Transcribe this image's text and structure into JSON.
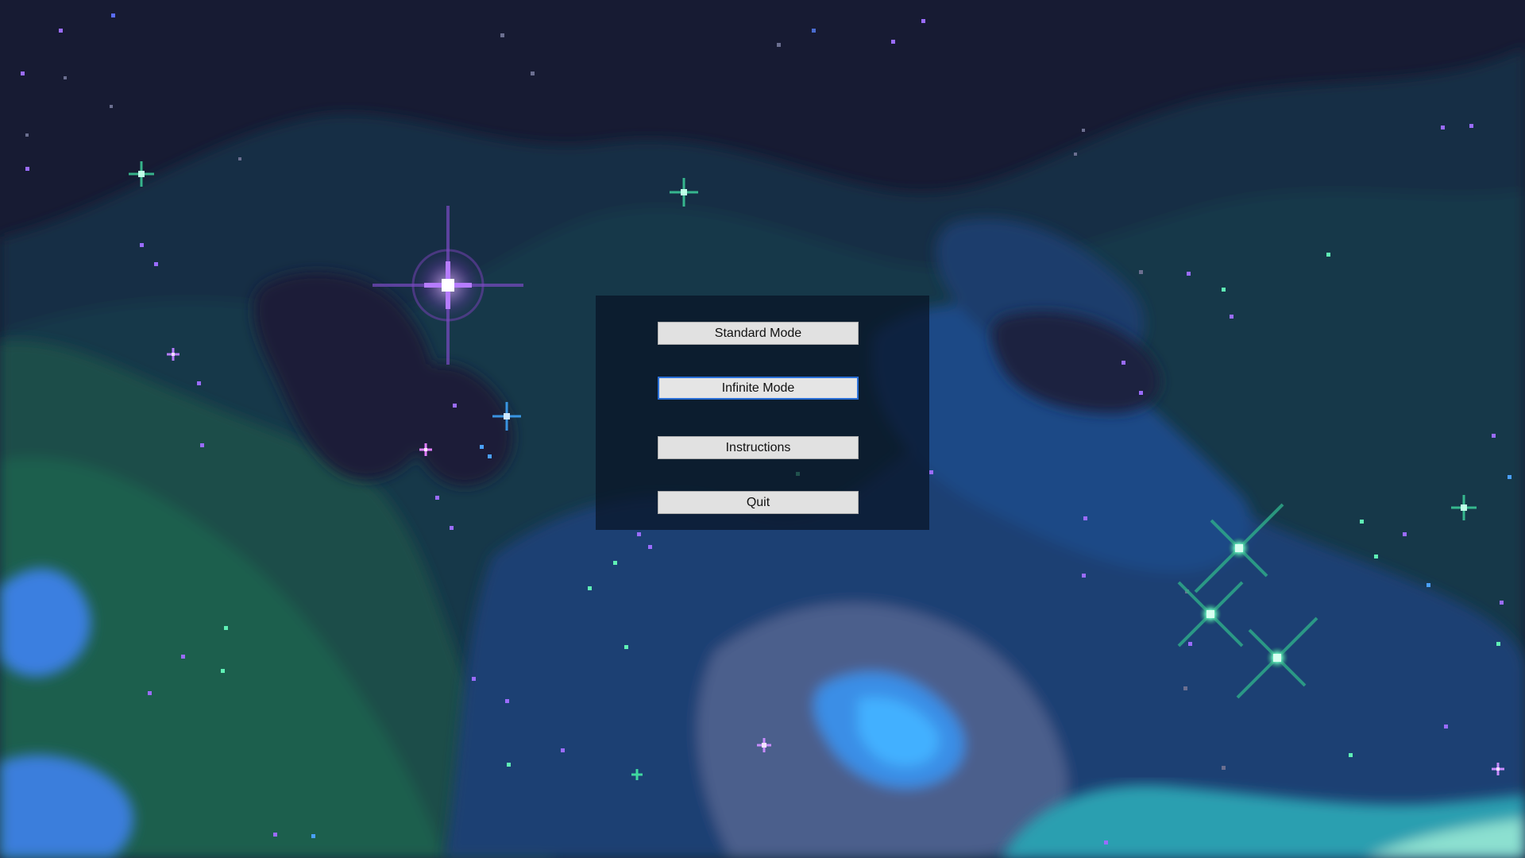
{
  "menu": {
    "buttons": [
      {
        "label": "Standard Mode",
        "focused": false
      },
      {
        "label": "Infinite Mode",
        "focused": true
      },
      {
        "label": "Instructions",
        "focused": false
      },
      {
        "label": "Quit",
        "focused": false
      }
    ]
  },
  "colors": {
    "sky": "#171b33",
    "nebula_teal": "#133a45",
    "nebula_green": "#1d5a4b",
    "nebula_blue": "#1b4a86",
    "nebula_light_blue": "#3b82e0",
    "nebula_gray": "#5a6c95",
    "star_purple": "#b67cff",
    "star_green": "#5ff0b5",
    "focus_border": "#2a6fd6"
  },
  "background": {
    "icons": [
      "pixel-nebula",
      "large-purple-star-icon",
      "green-star-cluster-icon",
      "sparkle-star-icon"
    ]
  }
}
